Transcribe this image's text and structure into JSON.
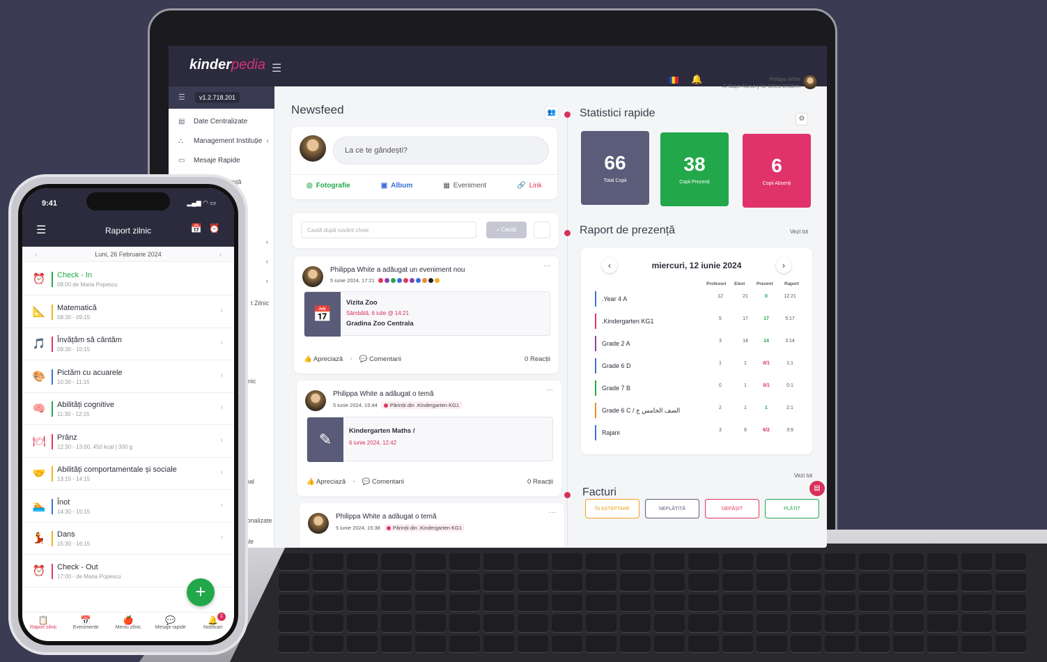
{
  "laptop": {
    "logo_main": "kinder",
    "logo_accent": "pedia",
    "version": "v1.2.718.201",
    "user_name": "Philippa White",
    "user_org": "Al Saqer Nursery for Gifted Children",
    "sidebar": {
      "items": [
        {
          "label": "Date Centralizate",
          "icon": "data-icon"
        },
        {
          "label": "Management Instituție",
          "icon": "org-icon"
        },
        {
          "label": "Mesaje Rapide",
          "icon": "message-icon"
        }
      ],
      "fragments": [
        "ință",
        "t Zilnic",
        "inic",
        "ănal",
        "ersonalizate",
        "oriale"
      ]
    },
    "newsfeed": {
      "title": "Newsfeed",
      "composer_placeholder": "La ce te gândești?",
      "actions": [
        "Fotografie",
        "Album",
        "Eveniment",
        "Link"
      ],
      "search_placeholder": "Caută după cuvânt cheie",
      "search_button": "Caută",
      "posts": [
        {
          "author_line": "Philippa White a adăugat un eveniment nou",
          "date": "5 iunie 2024, 17:21",
          "event_title": "Vizita Zoo",
          "event_date": "Sâmbătă, 6 iulie @ 14:21",
          "event_place": "Gradina Zoo Centrala",
          "like": "Apreciază",
          "comments": "Comentarii",
          "reactions": "0 Reacții"
        },
        {
          "author_line": "Philippa White a adăugat o temă",
          "date": "5 iunie 2024, 15:44",
          "audience": "Părinții din .Kindergarten KG1",
          "event_title": "Kindergarten Maths /",
          "event_date": "6 iunie 2024, 12:42",
          "like": "Apreciază",
          "comments": "Comentarii",
          "reactions": "0 Reacții"
        },
        {
          "author_line": "Philippa White a adăugat o temă",
          "date": "5 iunie 2024, 15:38",
          "audience": "Părinții din .Kindergarten KG1"
        }
      ]
    },
    "stats": {
      "title": "Statistici rapide",
      "cards": [
        {
          "value": "66",
          "label": "Total Copii",
          "color": "#5b5c7a"
        },
        {
          "value": "38",
          "label": "Copii Prezenți",
          "color": "#22a84a"
        },
        {
          "value": "6",
          "label": "Copii Absenți",
          "color": "#e0336b"
        }
      ]
    },
    "attendance": {
      "title": "Raport de prezență",
      "see_all": "Vezi tot",
      "date": "miercuri, 12 iunie 2024",
      "headers": [
        "Profesori",
        "Elevi",
        "Prezent",
        "Raport"
      ],
      "rows": [
        {
          "name": ".Year 4 A",
          "color": "#3a6fd8",
          "prof": "12",
          "elevi": "21",
          "prezent": "0",
          "raport": "12:21",
          "ps": "g"
        },
        {
          "name": ".Kindergarten KG1",
          "color": "#e0365c",
          "prof": "5",
          "elevi": "17",
          "prezent": "17",
          "raport": "5:17",
          "ps": "g"
        },
        {
          "name": "Grade 2 A",
          "color": "#8a3fb0",
          "prof": "3",
          "elevi": "14",
          "prezent": "14",
          "raport": "3:14",
          "ps": "g"
        },
        {
          "name": "Grade 6 D",
          "color": "#3a6fd8",
          "prof": "1",
          "elevi": "1",
          "prezent": "0/1",
          "raport": "1:1",
          "ps": "r"
        },
        {
          "name": "Grade 7 B",
          "color": "#22a84a",
          "prof": "0",
          "elevi": "1",
          "prezent": "0/1",
          "raport": "0:1",
          "ps": "r"
        },
        {
          "name": "Grade 6 C / الصف الخامس ج",
          "color": "#f08a24",
          "prof": "2",
          "elevi": "1",
          "prezent": "1",
          "raport": "2:1",
          "ps": "g"
        },
        {
          "name": "Rajani",
          "color": "#3a6fd8",
          "prof": "3",
          "elevi": "9",
          "prezent": "6/2",
          "raport": "3:9",
          "ps": "r"
        }
      ]
    },
    "invoices": {
      "title": "Facturi",
      "see_all": "Vezi tot",
      "buttons": [
        {
          "label": "ÎN AȘTEPTARE",
          "color": "#f0a020"
        },
        {
          "label": "NEPLĂTITĂ",
          "color": "#5b5c7a"
        },
        {
          "label": "DEPĂȘIT",
          "color": "#e0365c"
        },
        {
          "label": "PLĂTIT",
          "color": "#22a84a"
        }
      ]
    }
  },
  "phone": {
    "time": "9:41",
    "title": "Raport zilnic",
    "date": "Luni, 26 Februarie 2024",
    "items": [
      {
        "title": "Check - In",
        "sub": "08:00 de Maria Popescu",
        "icon": "alarm-check-icon",
        "glyph": "⏰",
        "color": "#22a84a",
        "title_color": "#22a84a"
      },
      {
        "title": "Matematică",
        "sub": "08:30 - 09:15",
        "icon": "math-icon",
        "glyph": "📐",
        "color": "#f0b020",
        "title_color": "#2d2d3a"
      },
      {
        "title": "Învățăm să cântăm",
        "sub": "09:30 - 10:15",
        "icon": "music-icon",
        "glyph": "🎵",
        "color": "#e0365c",
        "title_color": "#2d2d3a"
      },
      {
        "title": "Pictăm cu acuarele",
        "sub": "10:30 - 11:15",
        "icon": "paint-icon",
        "glyph": "🎨",
        "color": "#3a6fd8",
        "title_color": "#2d2d3a"
      },
      {
        "title": "Abilități cognitive",
        "sub": "11:30 - 12:15",
        "icon": "cognitive-icon",
        "glyph": "🧠",
        "color": "#22a84a",
        "title_color": "#2d2d3a"
      },
      {
        "title": "Prânz",
        "sub": "12:30 - 13:00, 450 kcal | 300 g",
        "icon": "lunch-icon",
        "glyph": "🍽",
        "color": "#e0365c",
        "title_color": "#2d2d3a"
      },
      {
        "title": "Abilități comportamentale și sociale",
        "sub": "13:15 - 14:15",
        "icon": "social-icon",
        "glyph": "🤝",
        "color": "#f0b020",
        "title_color": "#2d2d3a"
      },
      {
        "title": "Înot",
        "sub": "14:30 - 15:15",
        "icon": "swim-icon",
        "glyph": "🏊",
        "color": "#3a6fd8",
        "title_color": "#2d2d3a"
      },
      {
        "title": "Dans",
        "sub": "15:30 - 16:15",
        "icon": "dance-icon",
        "glyph": "💃",
        "color": "#f0b020",
        "title_color": "#2d2d3a"
      },
      {
        "title": "Check - Out",
        "sub": "17:00 - de Maria Popescu",
        "icon": "alarm-out-icon",
        "glyph": "⏰",
        "color": "#e0365c",
        "title_color": "#2d2d3a"
      }
    ],
    "tabs": [
      {
        "label": "Raport zilnic",
        "icon": "report-icon",
        "glyph": "📋"
      },
      {
        "label": "Evenimente",
        "icon": "events-icon",
        "glyph": "📅"
      },
      {
        "label": "Meniu zilnic",
        "icon": "menu-food-icon",
        "glyph": "🍎"
      },
      {
        "label": "Mesaje rapide",
        "icon": "messages-icon",
        "glyph": "💬"
      },
      {
        "label": "Notificari",
        "icon": "bell-icon",
        "glyph": "🔔"
      }
    ],
    "notif_count": "1"
  }
}
